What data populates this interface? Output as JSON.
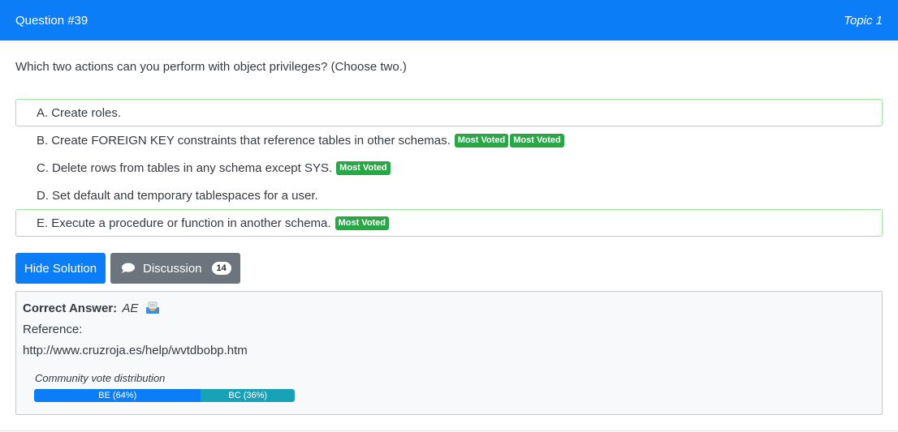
{
  "header": {
    "question_number": "Question #39",
    "topic": "Topic 1",
    "background_color": "#0a7df7"
  },
  "question": {
    "text": "Which two actions can you perform with object privileges? (Choose two.)"
  },
  "choices": [
    {
      "letter": "A.",
      "text": "Create roles.",
      "badges": [],
      "highlighted": true
    },
    {
      "letter": "B.",
      "text": "Create FOREIGN KEY constraints that reference tables in other schemas.",
      "badges": [
        "Most Voted",
        "Most Voted"
      ],
      "highlighted": false
    },
    {
      "letter": "C.",
      "text": "Delete rows from tables in any schema except SYS.",
      "badges": [
        "Most Voted"
      ],
      "highlighted": false
    },
    {
      "letter": "D.",
      "text": "Set default and temporary tablespaces for a user.",
      "badges": [],
      "highlighted": false
    },
    {
      "letter": "E.",
      "text": "Execute a procedure or function in another schema.",
      "badges": [
        "Most Voted"
      ],
      "highlighted": true
    }
  ],
  "buttons": {
    "hide_solution": "Hide Solution",
    "discussion": "Discussion",
    "discussion_count": "14",
    "icon": "chat-bubble-icon"
  },
  "answer": {
    "label": "Correct Answer:",
    "value": "AE",
    "icon": "archive-icon",
    "reference_label": "Reference:",
    "reference_url": "http://www.cruzroja.es/help/wvtdbobp.htm"
  },
  "community_vote": {
    "caption": "Community vote distribution",
    "segments": [
      {
        "label": "BE (64%)",
        "percent": 64,
        "color": "#0a7df7"
      },
      {
        "label": "BC (36%)",
        "percent": 36,
        "color": "#17a2b8"
      }
    ]
  },
  "colors": {
    "badge": "#28a745",
    "correct_border": "#9be29b",
    "discussion_button": "#6c757d"
  }
}
